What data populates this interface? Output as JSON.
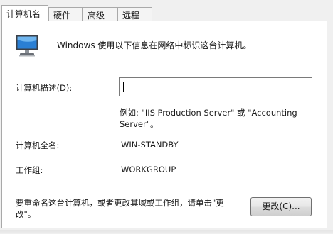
{
  "tabs": [
    {
      "label": "计算机名"
    },
    {
      "label": "硬件"
    },
    {
      "label": "高级"
    },
    {
      "label": "远程"
    }
  ],
  "info_text": "Windows 使用以下信息在网络中标识这台计算机。",
  "description": {
    "label": "计算机描述(D):",
    "value": "",
    "example_line1": "例如: \"IIS Production Server\" 或 \"Accounting",
    "example_line2": "Server\"。"
  },
  "full_name": {
    "label": "计算机全名:",
    "value": "WIN-STANDBY"
  },
  "workgroup": {
    "label": "工作组:",
    "value": "WORKGROUP"
  },
  "rename": {
    "text_line1": "要重命名这台计算机，或者更改其域或工作组，请单击\"更",
    "text_line2": "改\"。",
    "button_label": "更改(C)..."
  },
  "icons": {
    "computer": "computer-monitor-icon"
  }
}
